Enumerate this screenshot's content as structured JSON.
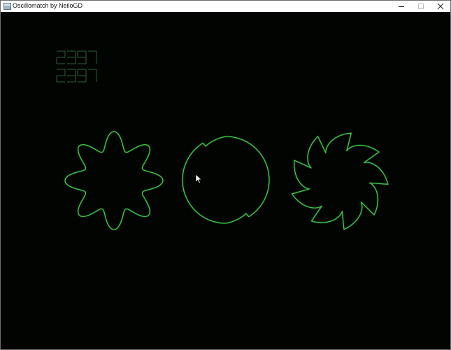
{
  "window": {
    "title": "Oscillomatch by NeiloGD",
    "icon": "app-window-icon",
    "controls": [
      "minimize-icon",
      "maximize-icon",
      "close-icon"
    ]
  },
  "game": {
    "score": "2397",
    "high_score": "2397",
    "colors": {
      "background": "#020402",
      "trace": "#3fd44a",
      "score": "#2f6a3a"
    },
    "shapes": [
      {
        "kind": "flower",
        "lobes": 8
      },
      {
        "kind": "notched-circle",
        "notches": 2
      },
      {
        "kind": "sawblade",
        "teeth": 9
      }
    ],
    "cursor": "mouse-pointer-icon"
  }
}
